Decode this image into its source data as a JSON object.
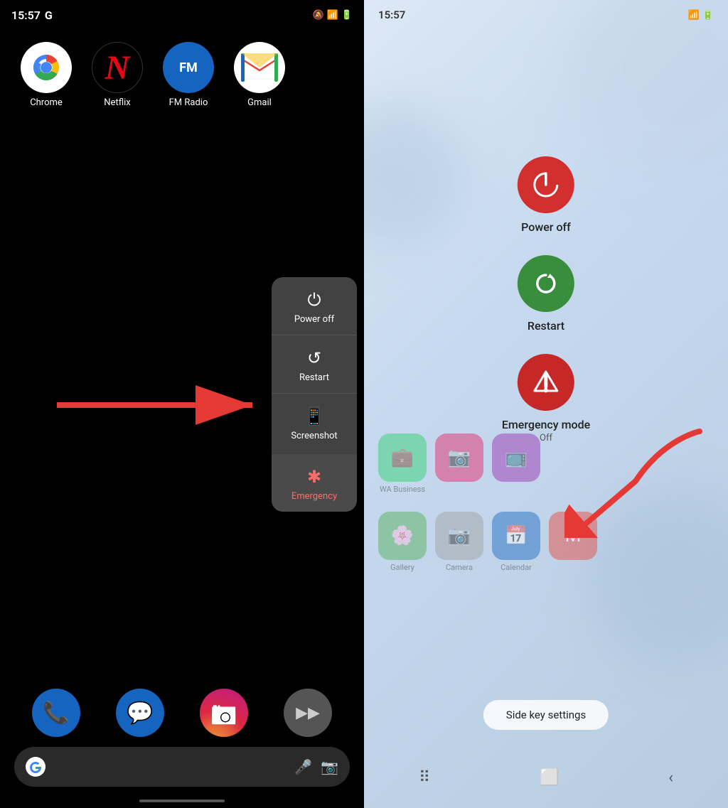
{
  "left": {
    "status": {
      "time": "15:57",
      "g_icon": "G",
      "silent_icon": "🔕",
      "signal_icon": "📶",
      "battery_icon": "🔋"
    },
    "apps": [
      {
        "name": "Chrome",
        "type": "chrome"
      },
      {
        "name": "Netflix",
        "type": "netflix"
      },
      {
        "name": "FM Radio",
        "type": "fm"
      },
      {
        "name": "Gmail",
        "type": "gmail"
      }
    ],
    "power_menu": {
      "items": [
        {
          "label": "Power off",
          "icon": "⏻"
        },
        {
          "label": "Restart",
          "icon": "↺"
        },
        {
          "label": "Screenshot",
          "icon": "📱"
        }
      ],
      "emergency": {
        "label": "Emergency",
        "icon": "✱"
      }
    },
    "dock": [
      {
        "name": "phone",
        "color": "#1565c0",
        "icon": "📞"
      },
      {
        "name": "messages",
        "color": "#1565c0",
        "icon": "💬"
      },
      {
        "name": "instagram",
        "color": "#c13584",
        "icon": "📷"
      },
      {
        "name": "assistant",
        "color": "#555",
        "icon": "▶"
      }
    ]
  },
  "right": {
    "power_menu": {
      "power_off": {
        "label": "Power off"
      },
      "restart": {
        "label": "Restart"
      },
      "emergency": {
        "label": "Emergency mode",
        "sublabel": "Off"
      }
    },
    "side_key_settings": "Side key settings",
    "bg_apps": [
      {
        "name": "WA Business",
        "color": "#25d366"
      },
      {
        "name": "Gallery",
        "color": "#e91e63"
      },
      {
        "name": "Camera",
        "color": "#9e9e9e"
      },
      {
        "name": "Calendar",
        "color": "#1565c0"
      },
      {
        "name": "Gmail",
        "color": "#ea4335"
      }
    ]
  }
}
